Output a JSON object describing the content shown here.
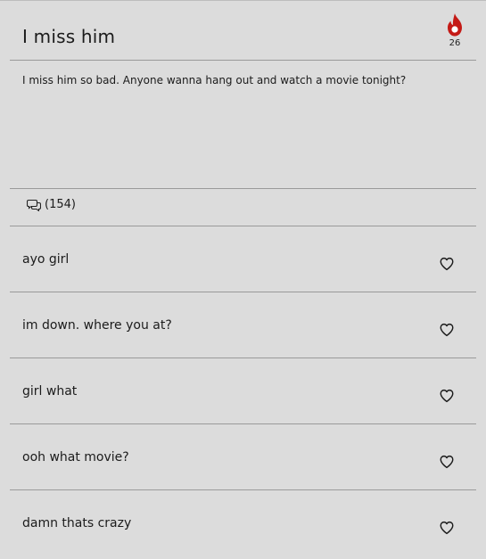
{
  "post": {
    "title": "I miss him",
    "body": "I miss him so bad. Anyone wanna hang out and watch a movie tonight?",
    "heat_count": "26",
    "comment_count": "(154)",
    "accent_color": "#c41a16"
  },
  "icons": {
    "heat": "flame-icon",
    "comments": "speech-bubbles-icon",
    "like": "heart-outline-icon"
  },
  "comments": [
    {
      "text": "ayo girl"
    },
    {
      "text": "im down. where you at?"
    },
    {
      "text": "girl what"
    },
    {
      "text": "ooh what movie?"
    },
    {
      "text": "damn thats crazy"
    }
  ]
}
